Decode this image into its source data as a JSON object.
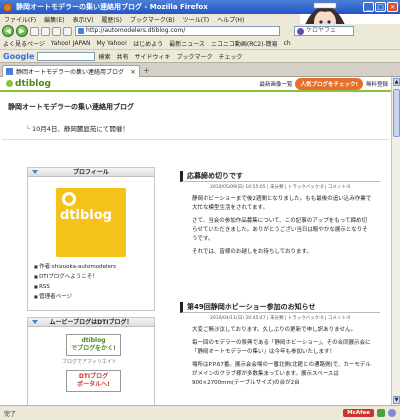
{
  "window": {
    "title": "静岡オートモデラーの集い連絡用ブログ - Mozilla Firefox"
  },
  "menu": [
    "ファイル(F)",
    "編集(E)",
    "表示(V)",
    "履歴(S)",
    "ブックマーク(B)",
    "ツール(T)",
    "ヘルプ(H)"
  ],
  "nav": {
    "url": "http://automodelers.dtiblog.com/",
    "search_value": "ケロヤフェ"
  },
  "bookmarks": [
    "よく見るページ",
    "Yahoo! JAPAN",
    "My Yahoo!",
    "はじめよう",
    "最新ニュース",
    "ニコニコ動画(RC2)-簡易",
    "ch"
  ],
  "google_bar": {
    "logo": "Google",
    "items": [
      "検索",
      "共有",
      "サイドウィキ",
      "ブックマーク",
      "チェック"
    ]
  },
  "tab": {
    "label": "静岡オートモデラーの集い連絡用ブログ"
  },
  "dti": {
    "logo": "dtiblog",
    "nav": [
      "最新画像一覧",
      "人気ブログをチェック!",
      "無料登録"
    ]
  },
  "blog": {
    "title": "静岡オートモデラーの集い連絡用ブログ",
    "subtitle": "10月4日、静岡麓庭苑にて開催！"
  },
  "profile": {
    "heading": "プロフィール",
    "logo_text": "dtiblog",
    "links": [
      "作者:shizuoka-automodelers",
      "DTIブログへようこそ！",
      "RSS",
      "管理者ページ"
    ]
  },
  "movie": {
    "heading": "ムービーブログはDTIブログ！",
    "banner1": "dtiblog\nでブログをかく!",
    "banner1_sub": "ブログでアフィリエイト",
    "banner2": "DTIブログ\nポータルへ!"
  },
  "articles": [
    {
      "title": "応募締め切りです",
      "meta": "2010/05/09(日) 10:55:05 | 未分類 | トラックバック:0 | コメント:0",
      "body": [
        "静岡ホビーショーまで後2週間となりました。もも最後の追い込み作業で大忙な模型生活をされてます。",
        "さて、当会の参加作品募集について、この記事のアップをもって締め切らせていただきました。ありがとうござい当日は賑やかな展示となりそうです。",
        "それでは、皆様のお越しをお待ちしております。"
      ]
    },
    {
      "title": "第49回静岡ホビーショー参加のお知らせ",
      "meta": "2010/04/11(日) 20:45:47 | 未分類 | トラックバック:0 | コメント:0",
      "body": [
        "大変ご無沙汰しております。久しぶりの更新で申し訳ありません。",
        "毎一回のモデラーの祭典である「静岡ホビーショー」。その合同展示会に「静岡オートモデラーの集い」は今年も参加いたします！",
        "場所はP.P.67番。展示会会場の一番北側(北館との通路側)で、カーモデルがメインのクラブ様が多数集まっています。展示スペースは900×2700mm(テーブルサイズ)の台が2台"
      ]
    }
  ],
  "status": {
    "text": "完了",
    "mcafee": "McAfee"
  }
}
